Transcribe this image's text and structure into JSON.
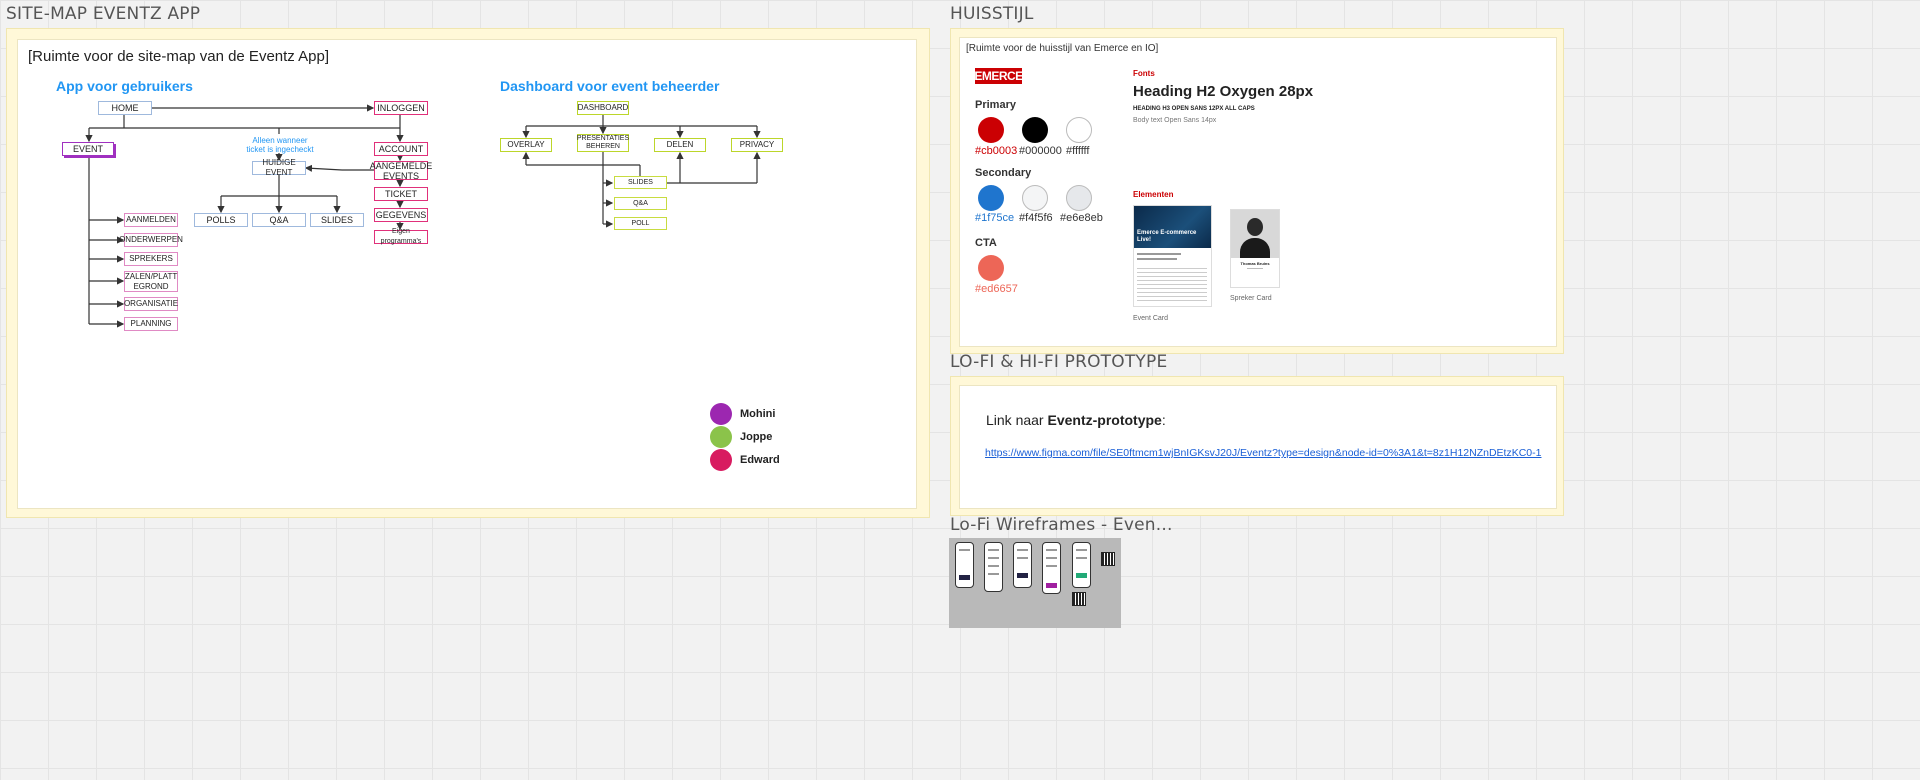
{
  "sitemap": {
    "frame_title": "SITE-MAP EVENTZ APP",
    "placeholder": "[Ruimte voor de site-map van de Eventz App]",
    "user_app": {
      "heading": "App voor gebruikers",
      "nodes": {
        "home": "HOME",
        "inloggen": "INLOGGEN",
        "event": "EVENT",
        "account": "ACCOUNT",
        "aangemelde_events": "AANGEMELDE EVENTS",
        "ticket": "TICKET",
        "gegevens": "GEGEVENS",
        "eigen": "Eigen programma's",
        "huidige_event": "HUIDIGE EVENT",
        "polls": "POLLS",
        "qa": "Q&A",
        "slides": "SLIDES",
        "aanmelden": "AANMELDEN",
        "onderwerpen": "ONDERWERPEN",
        "sprekers": "SPREKERS",
        "zalen": "ZALEN/PLATT EGROND",
        "organisatie": "ORGANISATIE",
        "planning": "PLANNING"
      },
      "note": "Alleen wanneer ticket is ingecheckt"
    },
    "dashboard": {
      "heading": "Dashboard voor event beheerder",
      "nodes": {
        "dashboard": "DASHBOARD",
        "overlay": "OVERLAY",
        "presentaties": "PRESENTATIES BEHEREN",
        "delen": "DELEN",
        "privacy": "PRIVACY",
        "slides": "SLIDES",
        "qa": "Q&A",
        "poll": "POLL"
      }
    },
    "legend": [
      {
        "name": "Mohini",
        "color": "#9c27b0"
      },
      {
        "name": "Joppe",
        "color": "#8bc34a"
      },
      {
        "name": "Edward",
        "color": "#d81b60"
      }
    ]
  },
  "huisstijl": {
    "frame_title": "HUISSTIJL",
    "placeholder": "[Ruimte voor de huisstijl van Emerce en IO]",
    "logo": "EMERCE",
    "primary_label": "Primary",
    "primary": [
      {
        "hex": "#cb0003",
        "color": "#cb0003",
        "text_color": "#cb0003"
      },
      {
        "hex": "#000000",
        "color": "#000000",
        "text_color": "#333333"
      },
      {
        "hex": "#ffffff",
        "color": "#ffffff",
        "text_color": "#333333"
      }
    ],
    "secondary_label": "Secondary",
    "secondary": [
      {
        "hex": "#1f75ce",
        "color": "#1f75ce",
        "text_color": "#1f75ce"
      },
      {
        "hex": "#f4f5f6",
        "color": "#f4f5f6",
        "text_color": "#333333"
      },
      {
        "hex": "#e6e8eb",
        "color": "#e6e8eb",
        "text_color": "#333333"
      }
    ],
    "cta_label": "CTA",
    "cta": {
      "hex": "#ed6657",
      "color": "#ed6657",
      "text_color": "#ed6657"
    },
    "fonts_label": "Fonts",
    "heading_h2": "Heading H2 Oxygen 28px",
    "heading_h3": "HEADING H3 OPEN SANS 12PX ALL CAPS",
    "body_text": "Body text Open Sans 14px",
    "elementen_label": "Elementen",
    "event_card": {
      "title": "Emerce E-commerce Live!",
      "caption": "Event Card"
    },
    "spreker_card": {
      "name": "Thomas Bruins",
      "caption": "Spreker Card"
    }
  },
  "prototype": {
    "frame_title": "LO-FI & HI-FI PROTOTYPE",
    "link_prefix": "Link naar ",
    "link_bold": "Eventz-prototype",
    "link_suffix": ":",
    "url": "https://www.figma.com/file/SE0ftmcm1wjBnIGKsvJ20J/Eventz?type=design&node-id=0%3A1&t=8z1H12NZnDEtzKC0-1"
  },
  "wireframes": {
    "frame_title": "Lo-Fi Wireframes - Even..."
  }
}
